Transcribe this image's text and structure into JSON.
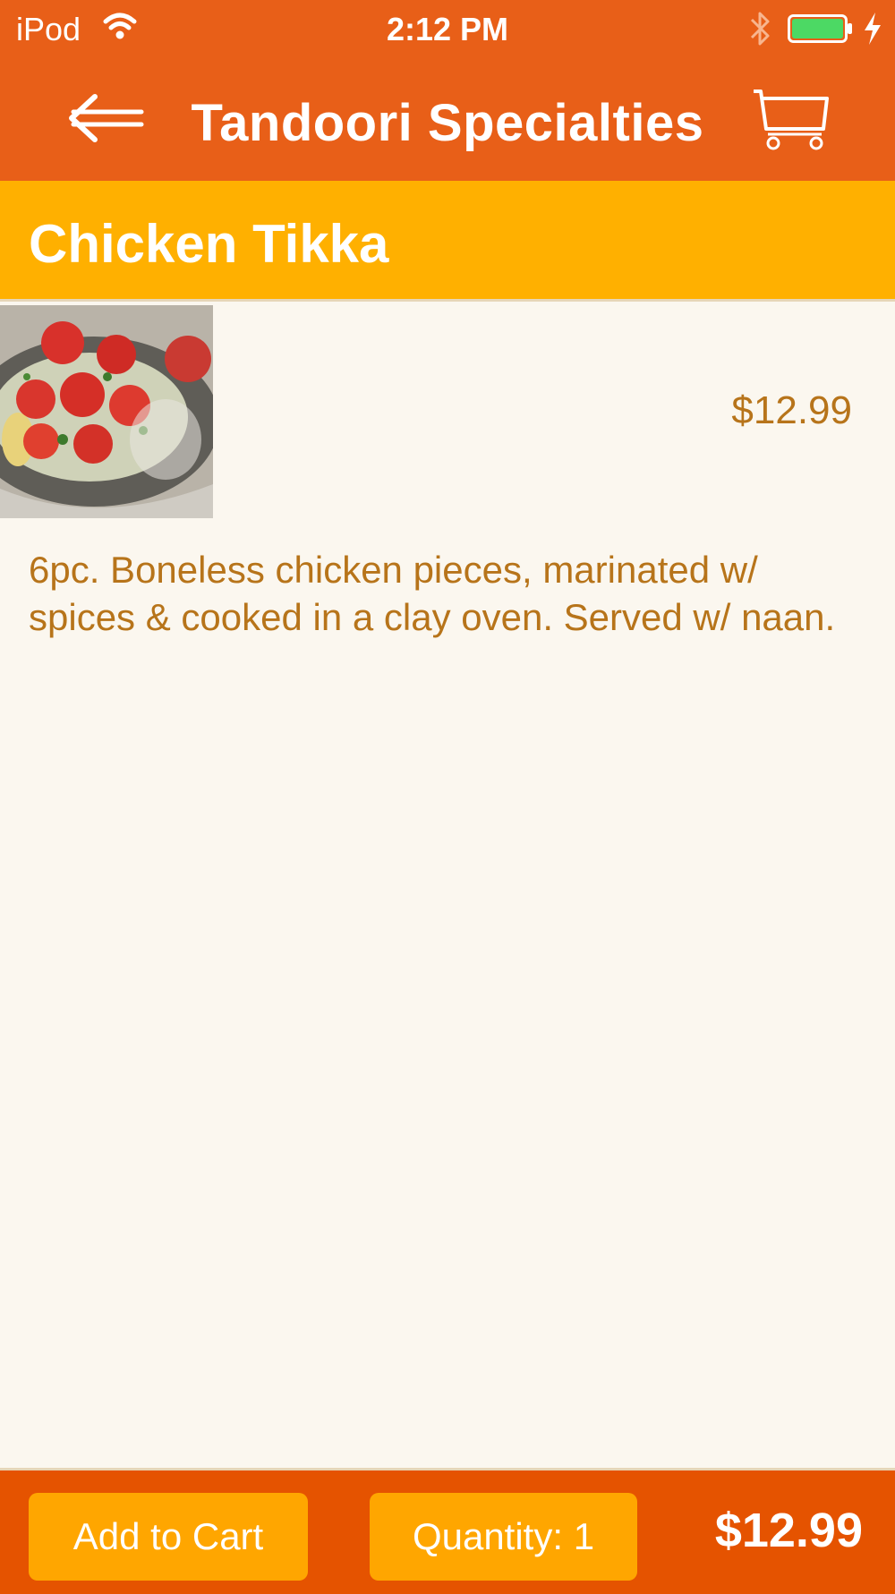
{
  "status_bar": {
    "carrier": "iPod",
    "time": "2:12 PM",
    "icons": [
      "wifi-icon",
      "bluetooth-icon",
      "battery-icon",
      "charging-icon"
    ],
    "battery_color": "#4cd964"
  },
  "nav": {
    "title": "Tandoori Specialties",
    "back_icon": "back-arrow-icon",
    "cart_icon": "cart-icon"
  },
  "item": {
    "name": "Chicken Tikka",
    "price": "$12.99",
    "description": "6pc. Boneless chicken pieces, marinated w/ spices & cooked in a clay oven. Served w/ naan."
  },
  "footer": {
    "add_to_cart_label": "Add to Cart",
    "quantity_label": "Quantity: 1",
    "total": "$12.99"
  },
  "colors": {
    "nav_bg": "#e85f18",
    "header_bg": "#ffb000",
    "page_bg": "#fbf7ef",
    "text_accent": "#b7741a",
    "footer_bg": "#e55300",
    "button_bg": "#ffa600"
  }
}
